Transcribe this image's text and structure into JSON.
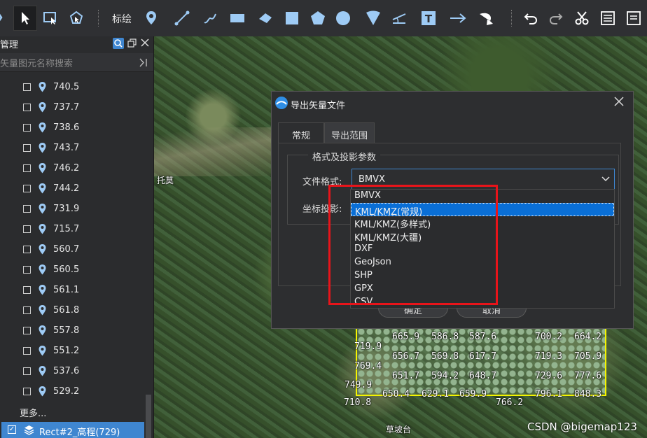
{
  "toolbar": {
    "label": "标绘",
    "icons": [
      "undo-partial-icon",
      "select-arrow-icon",
      "screenshot-select-icon",
      "shape-edit-icon",
      "pin-icon",
      "line-icon",
      "curve-icon",
      "rectangle-icon",
      "polygon-arrow-icon",
      "square-icon",
      "pentagon-icon",
      "circle-icon",
      "sector-icon",
      "measure-icon",
      "text-icon",
      "arrow-icon",
      "curved-arrow-icon",
      "undo-icon",
      "redo-icon",
      "scissors-icon",
      "attribute-table-icon",
      "export-icon"
    ]
  },
  "left_panel": {
    "title": "管理",
    "search_placeholder": "矢量图元名称搜索",
    "items": [
      "740.5",
      "737.7",
      "738.6",
      "743.7",
      "746.2",
      "744.2",
      "731.9",
      "715.7",
      "560.7",
      "560.5",
      "561.1",
      "561.8",
      "557.8",
      "551.2",
      "537.6",
      "529.2"
    ],
    "more": "更多...",
    "layer": "Rect#2_高程(729)"
  },
  "map": {
    "labels": {
      "tuomo": "托莫",
      "caopotai": "草坡台"
    },
    "grid_values": [
      [
        "665.9",
        "586.8",
        "587.6",
        "",
        "700.2",
        "664.2"
      ],
      [
        "719.9"
      ],
      [
        "656.7",
        "569.8",
        "617.7",
        "",
        "719.3",
        "705.9"
      ],
      [
        "769.4"
      ],
      [
        "651.7",
        "594.2",
        "648.7",
        "",
        "729.6",
        "777.6"
      ],
      [
        "749.9"
      ],
      [
        "650.4",
        "629.1",
        "659.9",
        "",
        "796.1",
        "848.3"
      ]
    ],
    "bottom_values": [
      "710.8",
      "766.2"
    ]
  },
  "dialog": {
    "title": "导出矢量文件",
    "tabs": [
      "常规",
      "导出范围"
    ],
    "group_title": "格式及投影参数",
    "format_label": "文件格式:",
    "projection_label": "坐标投影:",
    "format_value": "BMVX",
    "ok_label": "确定",
    "cancel_label": "取消",
    "options": [
      "BMVX",
      "KML/KMZ(常规)",
      "KML/KMZ(多样式)",
      "KML/KMZ(大疆)",
      "DXF",
      "GeoJson",
      "SHP",
      "GPX",
      "CSV"
    ],
    "selected_option": "KML/KMZ(常规)"
  },
  "watermark": "CSDN @bigemap123",
  "colors": {
    "accent": "#3f86d0",
    "selection": "#0a6fd6",
    "highlight_box": "#e8141a",
    "grid_border": "#f5f500"
  }
}
